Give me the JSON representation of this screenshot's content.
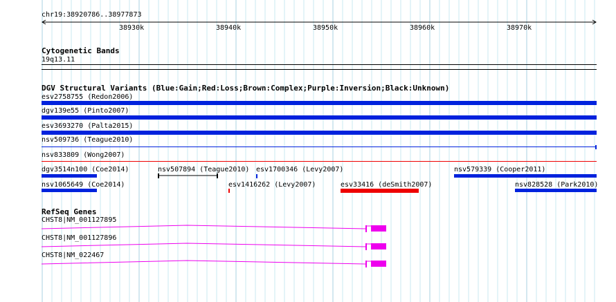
{
  "ruler": {
    "location": "chr19:38920786..38977873",
    "ticks": [
      "38930k",
      "38940k",
      "38950k",
      "38960k",
      "38970k"
    ]
  },
  "cyto": {
    "title": "Cytogenetic Bands",
    "band": "19q13.11"
  },
  "dgv": {
    "title": "DGV Structural Variants (Blue:Gain;Red:Loss;Brown:Complex;Purple:Inversion;Black:Unknown)",
    "features": [
      {
        "label": "esv2758755 (Redon2006)"
      },
      {
        "label": "dgv139e55 (Pinto2007)"
      },
      {
        "label": "esv3693270 (Palta2015)"
      },
      {
        "label": "nsv509736 (Teague2010)"
      },
      {
        "label": "nsv833809 (Wong2007)"
      },
      {
        "label": "dgv3514n100 (Coe2014)"
      },
      {
        "label": "nsv507894 (Teague2010)"
      },
      {
        "label": "esv1700346 (Levy2007)"
      },
      {
        "label": "nsv579339 (Cooper2011)"
      },
      {
        "label": "nsv1065649 (Coe2014)"
      },
      {
        "label": "esv1416262 (Levy2007)"
      },
      {
        "label": "esv33416 (deSmith2007)"
      },
      {
        "label": "nsv828528 (Park2010)"
      }
    ]
  },
  "refseq": {
    "title": "RefSeq Genes",
    "genes": [
      {
        "label": "CHST8|NM_001127895"
      },
      {
        "label": "CHST8|NM_001127896"
      },
      {
        "label": "CHST8|NM_022467"
      }
    ]
  },
  "colors": {
    "gain": "#0022dd",
    "loss": "#ee0000",
    "unknown": "#000000",
    "gene": "#ee00ee",
    "grid": "#c8e8f0"
  }
}
